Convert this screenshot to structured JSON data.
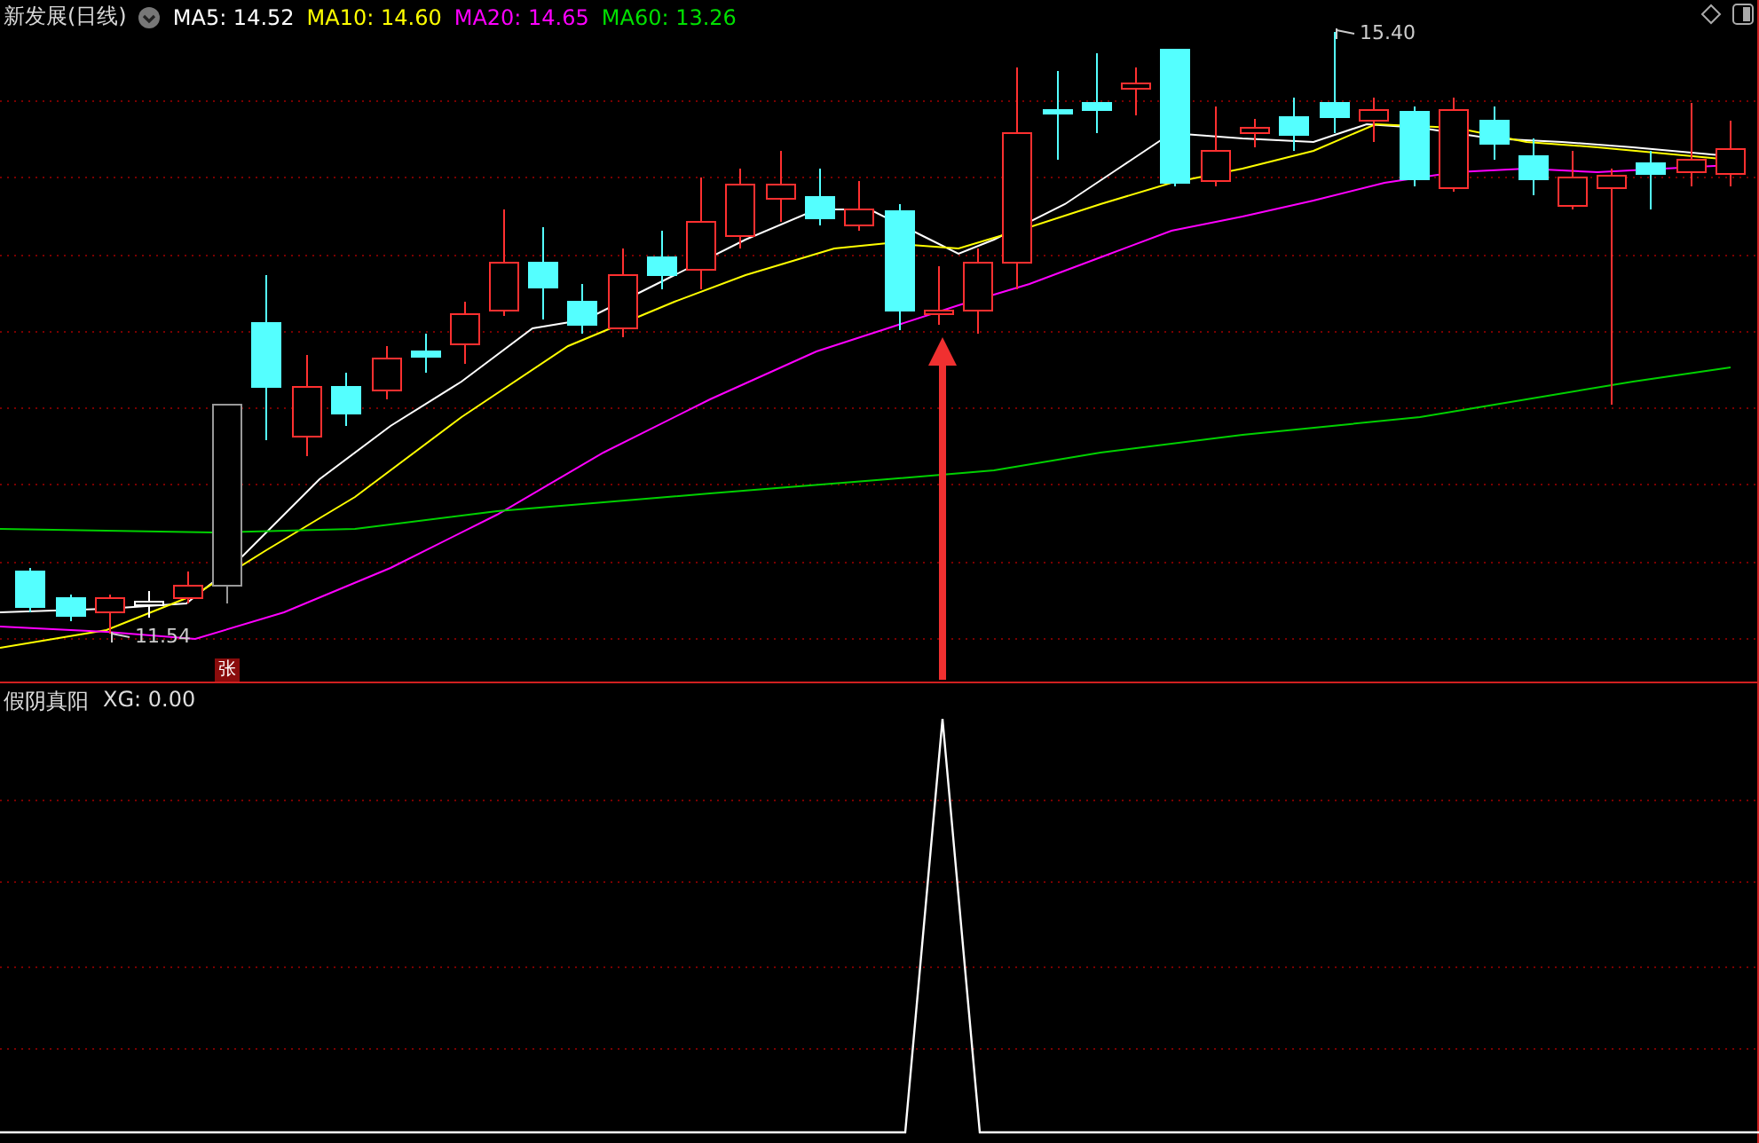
{
  "header": {
    "title": "新发展(日线)",
    "indicators": [
      {
        "label": "MA5: 14.52",
        "color": "#ffffff"
      },
      {
        "label": "MA10: 14.60",
        "color": "#ffff00"
      },
      {
        "label": "MA20: 14.65",
        "color": "#ff00ff"
      },
      {
        "label": "MA60: 13.26",
        "color": "#00e000"
      }
    ]
  },
  "price_labels": [
    {
      "kind": "high",
      "text": "15.40"
    },
    {
      "kind": "low",
      "text": "11.54"
    }
  ],
  "badge": "张",
  "indicator_panel": {
    "title": "假阴真阳",
    "reading": "XG: 0.00"
  }
}
